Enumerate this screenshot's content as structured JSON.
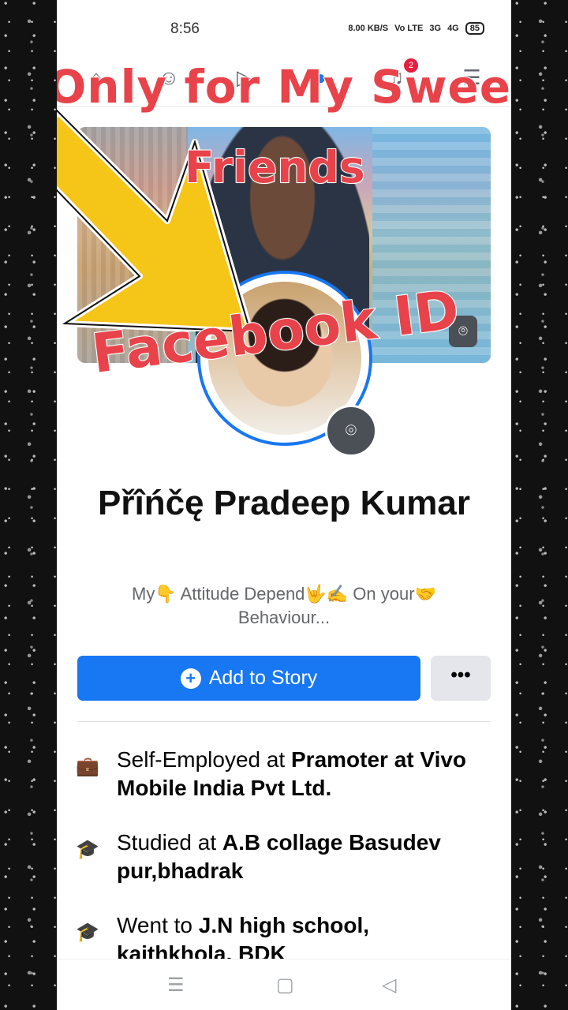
{
  "status_bar": {
    "time": "8:56",
    "speed": "8.00 KB/S",
    "volte": "Vo LTE",
    "net1": "3G",
    "net2": "4G",
    "battery": "85"
  },
  "nav": {
    "icons": [
      "home-icon",
      "friends-icon",
      "watch-icon",
      "profile-icon",
      "notifications-icon",
      "menu-icon"
    ],
    "notification_count": "2"
  },
  "overlay": {
    "line1": "Only for My Sweet",
    "line2": "Friends",
    "line3": "Facebook ID",
    "color": "#e8434a"
  },
  "profile": {
    "name": "Přîńčę Pradeep Kumar",
    "bio": "My👇 Attitude Depend🤟✍️ On your🤝 Behaviour..."
  },
  "actions": {
    "add_story_label": "Add to Story",
    "more_label": "•••"
  },
  "info": [
    {
      "prefix": "Self-Employed at ",
      "bold": "Pramoter at Vivo Mobile India Pvt Ltd.",
      "icon": "briefcase-icon"
    },
    {
      "prefix": "Studied at ",
      "bold": "A.B collage Basudev pur,bhadrak",
      "icon": "graduation-cap-icon"
    },
    {
      "prefix": "Went to ",
      "bold": "J.N high school, kaithkhola, BDK",
      "icon": "graduation-cap-icon"
    }
  ],
  "colors": {
    "accent": "#1877f2",
    "badge": "#e41e3f",
    "arrow": "#f5c518"
  }
}
